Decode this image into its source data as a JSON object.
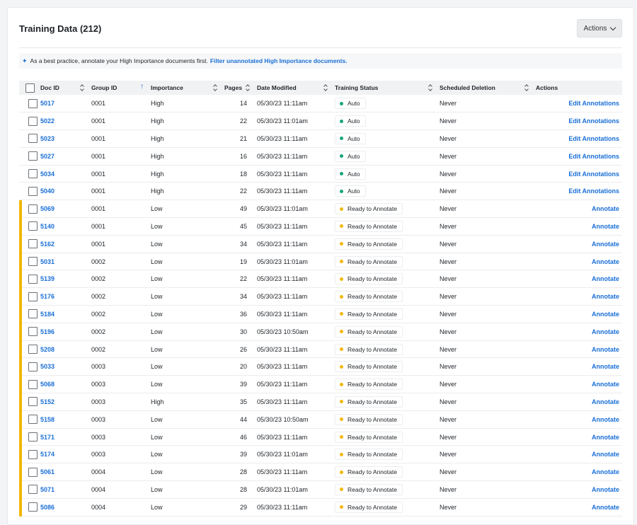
{
  "header": {
    "title": "Training Data (212)",
    "actions_label": "Actions"
  },
  "banner": {
    "text": "As a best practice, annotate your High Importance documents first.",
    "link": "Filter unannotated High Importance documents."
  },
  "colors": {
    "accent": "#1a6fd6",
    "auto_dot": "#16a37a",
    "ready_dot": "#f2b705",
    "low_flag": "#f2b705"
  },
  "table": {
    "columns": {
      "doc_id": "Doc ID",
      "group_id": "Group ID",
      "importance": "Importance",
      "pages": "Pages",
      "date_modified": "Date Modified",
      "training_status": "Training Status",
      "scheduled_deletion": "Scheduled Deletion",
      "actions": "Actions"
    },
    "rows": [
      {
        "doc_id": "5017",
        "group_id": "0001",
        "importance": "High",
        "pages": "14",
        "date": "05/30/23 11:11am",
        "status": "Auto",
        "deletion": "Never",
        "action": "Edit Annotations"
      },
      {
        "doc_id": "5022",
        "group_id": "0001",
        "importance": "High",
        "pages": "22",
        "date": "05/30/23 11:01am",
        "status": "Auto",
        "deletion": "Never",
        "action": "Edit Annotations"
      },
      {
        "doc_id": "5023",
        "group_id": "0001",
        "importance": "High",
        "pages": "21",
        "date": "05/30/23 11:11am",
        "status": "Auto",
        "deletion": "Never",
        "action": "Edit Annotations"
      },
      {
        "doc_id": "5027",
        "group_id": "0001",
        "importance": "High",
        "pages": "16",
        "date": "05/30/23 11:11am",
        "status": "Auto",
        "deletion": "Never",
        "action": "Edit Annotations"
      },
      {
        "doc_id": "5034",
        "group_id": "0001",
        "importance": "High",
        "pages": "18",
        "date": "05/30/23 11:11am",
        "status": "Auto",
        "deletion": "Never",
        "action": "Edit Annotations"
      },
      {
        "doc_id": "5040",
        "group_id": "0001",
        "importance": "High",
        "pages": "22",
        "date": "05/30/23 11:11am",
        "status": "Auto",
        "deletion": "Never",
        "action": "Edit Annotations"
      },
      {
        "doc_id": "5069",
        "group_id": "0001",
        "importance": "Low",
        "pages": "49",
        "date": "05/30/23 11:01am",
        "status": "Ready to Annotate",
        "deletion": "Never",
        "action": "Annotate"
      },
      {
        "doc_id": "5140",
        "group_id": "0001",
        "importance": "Low",
        "pages": "45",
        "date": "05/30/23 11:11am",
        "status": "Ready to Annotate",
        "deletion": "Never",
        "action": "Annotate"
      },
      {
        "doc_id": "5162",
        "group_id": "0001",
        "importance": "Low",
        "pages": "34",
        "date": "05/30/23 11:11am",
        "status": "Ready to Annotate",
        "deletion": "Never",
        "action": "Annotate"
      },
      {
        "doc_id": "5031",
        "group_id": "0002",
        "importance": "Low",
        "pages": "19",
        "date": "05/30/23 11:01am",
        "status": "Ready to Annotate",
        "deletion": "Never",
        "action": "Annotate"
      },
      {
        "doc_id": "5139",
        "group_id": "0002",
        "importance": "Low",
        "pages": "22",
        "date": "05/30/23 11:11am",
        "status": "Ready to Annotate",
        "deletion": "Never",
        "action": "Annotate"
      },
      {
        "doc_id": "5176",
        "group_id": "0002",
        "importance": "Low",
        "pages": "34",
        "date": "05/30/23 11:11am",
        "status": "Ready to Annotate",
        "deletion": "Never",
        "action": "Annotate"
      },
      {
        "doc_id": "5184",
        "group_id": "0002",
        "importance": "Low",
        "pages": "36",
        "date": "05/30/23 11:11am",
        "status": "Ready to Annotate",
        "deletion": "Never",
        "action": "Annotate"
      },
      {
        "doc_id": "5196",
        "group_id": "0002",
        "importance": "Low",
        "pages": "30",
        "date": "05/30/23 10:50am",
        "status": "Ready to Annotate",
        "deletion": "Never",
        "action": "Annotate"
      },
      {
        "doc_id": "5208",
        "group_id": "0002",
        "importance": "Low",
        "pages": "26",
        "date": "05/30/23 11:11am",
        "status": "Ready to Annotate",
        "deletion": "Never",
        "action": "Annotate"
      },
      {
        "doc_id": "5033",
        "group_id": "0003",
        "importance": "Low",
        "pages": "20",
        "date": "05/30/23 11:11am",
        "status": "Ready to Annotate",
        "deletion": "Never",
        "action": "Annotate"
      },
      {
        "doc_id": "5068",
        "group_id": "0003",
        "importance": "Low",
        "pages": "39",
        "date": "05/30/23 11:11am",
        "status": "Ready to Annotate",
        "deletion": "Never",
        "action": "Annotate"
      },
      {
        "doc_id": "5152",
        "group_id": "0003",
        "importance": "High",
        "pages": "35",
        "date": "05/30/23 11:11am",
        "status": "Ready to Annotate",
        "deletion": "Never",
        "action": "Annotate"
      },
      {
        "doc_id": "5158",
        "group_id": "0003",
        "importance": "Low",
        "pages": "44",
        "date": "05/30/23 10:50am",
        "status": "Ready to Annotate",
        "deletion": "Never",
        "action": "Annotate"
      },
      {
        "doc_id": "5171",
        "group_id": "0003",
        "importance": "Low",
        "pages": "46",
        "date": "05/30/23 11:11am",
        "status": "Ready to Annotate",
        "deletion": "Never",
        "action": "Annotate"
      },
      {
        "doc_id": "5174",
        "group_id": "0003",
        "importance": "Low",
        "pages": "39",
        "date": "05/30/23 11:01am",
        "status": "Ready to Annotate",
        "deletion": "Never",
        "action": "Annotate"
      },
      {
        "doc_id": "5061",
        "group_id": "0004",
        "importance": "Low",
        "pages": "28",
        "date": "05/30/23 11:11am",
        "status": "Ready to Annotate",
        "deletion": "Never",
        "action": "Annotate"
      },
      {
        "doc_id": "5071",
        "group_id": "0004",
        "importance": "Low",
        "pages": "28",
        "date": "05/30/23 11:01am",
        "status": "Ready to Annotate",
        "deletion": "Never",
        "action": "Annotate"
      },
      {
        "doc_id": "5086",
        "group_id": "0004",
        "importance": "Low",
        "pages": "29",
        "date": "05/30/23 11:11am",
        "status": "Ready to Annotate",
        "deletion": "Never",
        "action": "Annotate"
      }
    ]
  }
}
